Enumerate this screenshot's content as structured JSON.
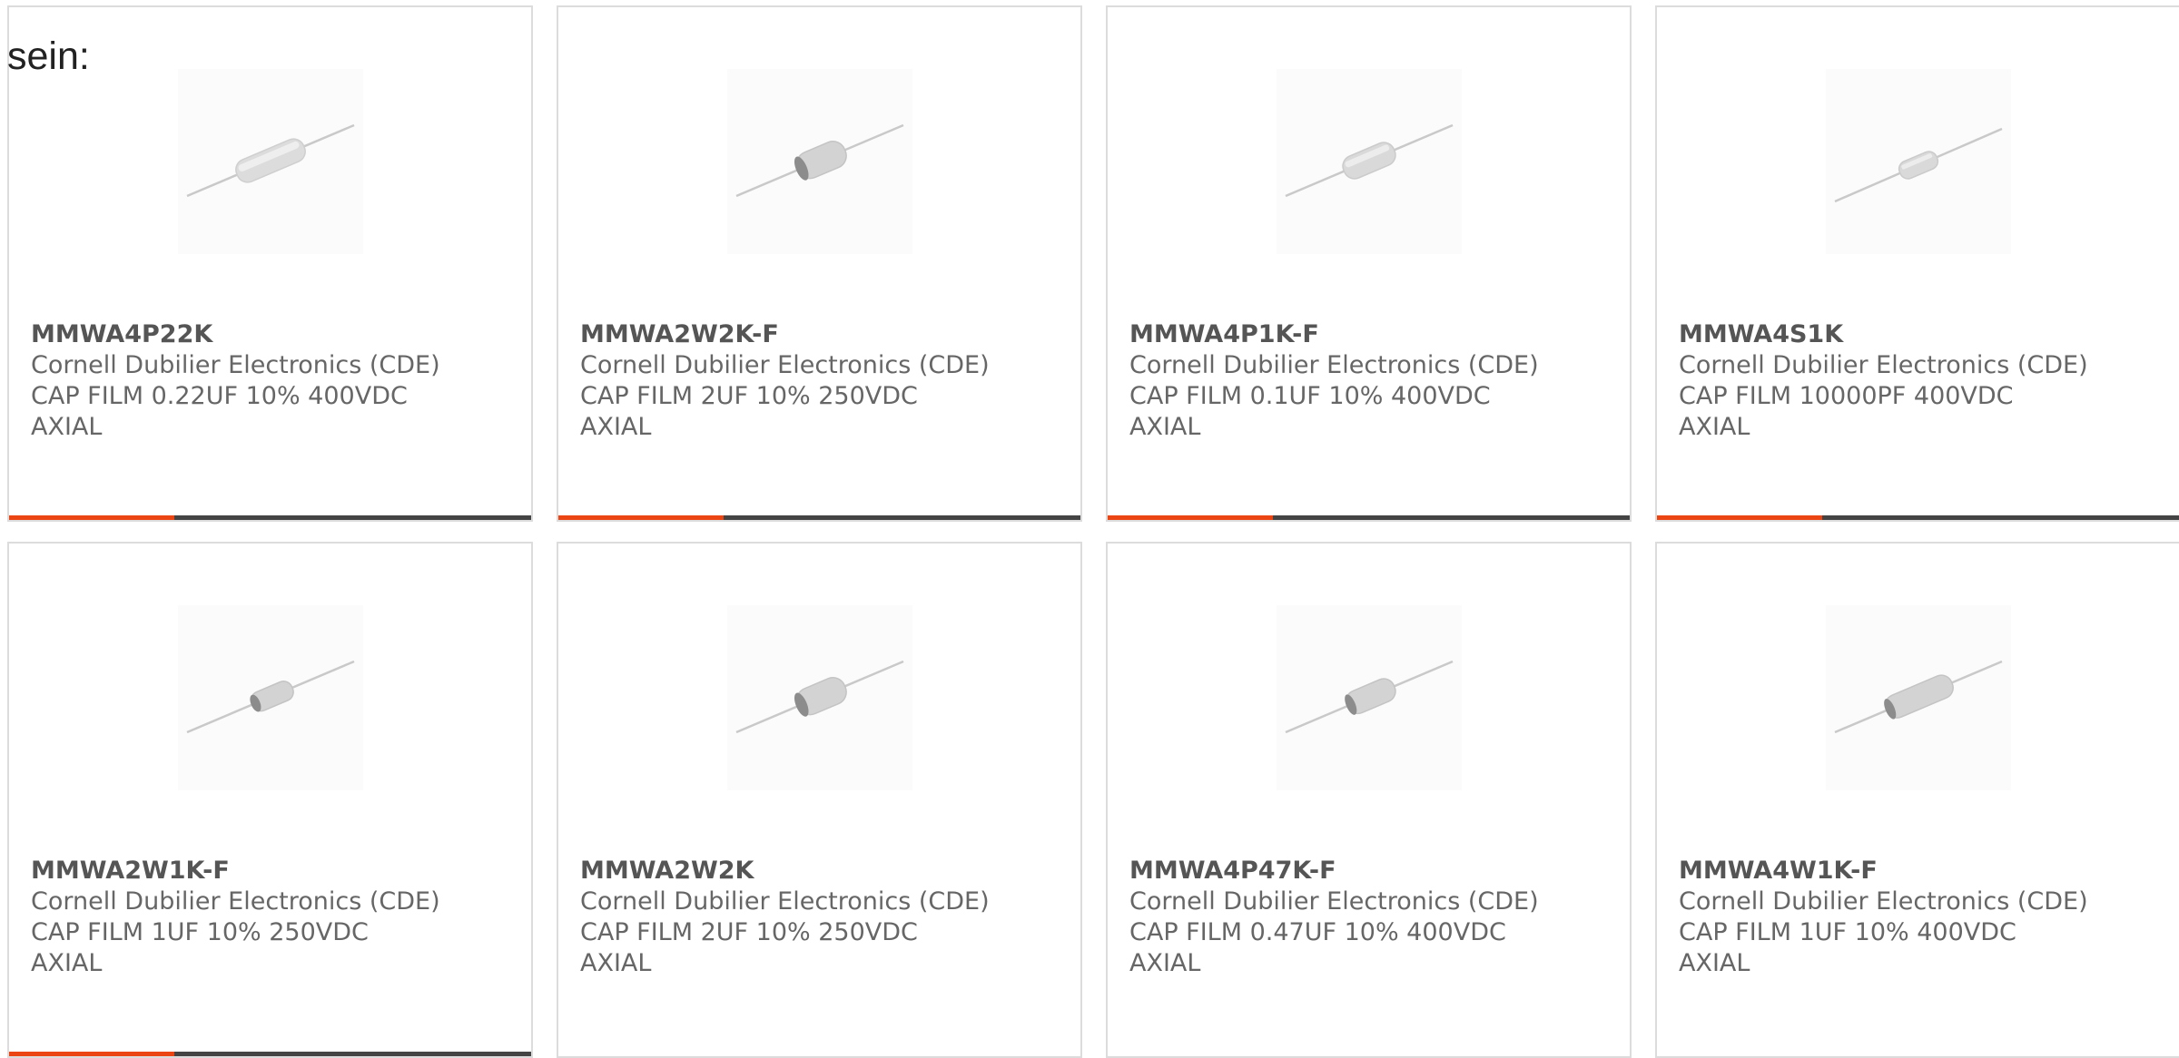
{
  "intro_text": "sein:",
  "colors": {
    "accent": "#ea4512",
    "bar": "#444444",
    "border": "#dcdcdc",
    "text": "#666666"
  },
  "products": [
    {
      "part_number": "MMWA4P22K",
      "manufacturer": "Cornell Dubilier Electronics (CDE)",
      "desc_line1": "CAP FILM 0.22UF 10% 400VDC",
      "desc_line2": "AXIAL",
      "image": "axial-film-capacitor-icon"
    },
    {
      "part_number": "MMWA2W2K-F",
      "manufacturer": "Cornell Dubilier Electronics (CDE)",
      "desc_line1": "CAP FILM 2UF 10% 250VDC",
      "desc_line2": "AXIAL",
      "image": "axial-film-capacitor-icon"
    },
    {
      "part_number": "MMWA4P1K-F",
      "manufacturer": "Cornell Dubilier Electronics (CDE)",
      "desc_line1": "CAP FILM 0.1UF 10% 400VDC",
      "desc_line2": "AXIAL",
      "image": "axial-film-capacitor-icon"
    },
    {
      "part_number": "MMWA4S1K",
      "manufacturer": "Cornell Dubilier Electronics (CDE)",
      "desc_line1": "CAP FILM 10000PF 400VDC",
      "desc_line2": "AXIAL",
      "image": "axial-film-capacitor-icon"
    },
    {
      "part_number": "MMWA2W1K-F",
      "manufacturer": "Cornell Dubilier Electronics (CDE)",
      "desc_line1": "CAP FILM 1UF 10% 250VDC",
      "desc_line2": "AXIAL",
      "image": "axial-film-capacitor-icon"
    },
    {
      "part_number": "MMWA2W2K",
      "manufacturer": "Cornell Dubilier Electronics (CDE)",
      "desc_line1": "CAP FILM 2UF 10% 250VDC",
      "desc_line2": "AXIAL",
      "image": "axial-film-capacitor-icon"
    },
    {
      "part_number": "MMWA4P47K-F",
      "manufacturer": "Cornell Dubilier Electronics (CDE)",
      "desc_line1": "CAP FILM 0.47UF 10% 400VDC",
      "desc_line2": "AXIAL",
      "image": "axial-film-capacitor-icon"
    },
    {
      "part_number": "MMWA4W1K-F",
      "manufacturer": "Cornell Dubilier Electronics (CDE)",
      "desc_line1": "CAP FILM 1UF 10% 400VDC",
      "desc_line2": "AXIAL",
      "image": "axial-film-capacitor-icon"
    }
  ]
}
